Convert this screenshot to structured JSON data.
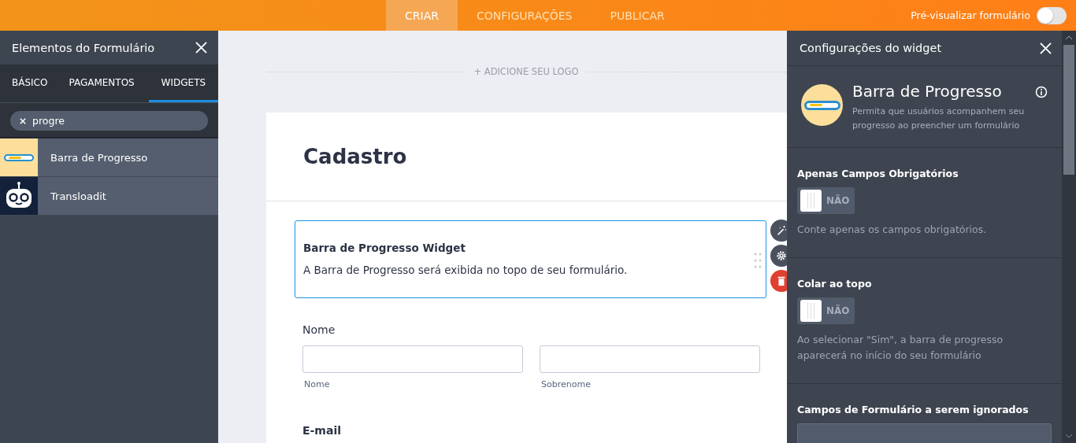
{
  "top_tabs": [
    {
      "label": "CRIAR",
      "selected": true
    },
    {
      "label": "CONFIGURAÇÕES",
      "selected": false
    },
    {
      "label": "PUBLICAR",
      "selected": false
    }
  ],
  "preview": {
    "label": "Pré-visualizar formulário",
    "on": false
  },
  "left_panel": {
    "title": "Elementos do Formulário",
    "tabs": [
      {
        "label": "BÁSICO",
        "selected": false
      },
      {
        "label": "PAGAMENTOS",
        "selected": false
      },
      {
        "label": "WIDGETS",
        "selected": true
      }
    ],
    "search": {
      "value": "progre"
    },
    "items": [
      {
        "label": "Barra de Progresso",
        "kind": "progress"
      },
      {
        "label": "Transloadit",
        "kind": "robot"
      }
    ]
  },
  "form": {
    "add_logo": "+ ADICIONE SEU LOGO",
    "title": "Cadastro",
    "widget": {
      "title": "Barra de Progresso Widget",
      "text": "A Barra de Progresso será exibida no topo de seu formulário."
    },
    "name_field": {
      "label": "Nome",
      "sublabels": [
        "Nome",
        "Sobrenome"
      ]
    },
    "email_label": "E-mail"
  },
  "right_panel": {
    "title": "Configurações do widget",
    "widget_name": "Barra de Progresso",
    "widget_desc": "Permita que usuários acompanhem seu progresso ao preencher um formulário",
    "settings": [
      {
        "kind": "toggle",
        "label": "Apenas Campos Obrigatórios",
        "on": false,
        "toggle_text": "NÃO",
        "hint": "Conte apenas os campos obrigatórios."
      },
      {
        "kind": "toggle",
        "label": "Colar ao topo",
        "on": false,
        "toggle_text": "NÃO",
        "hint": "Ao selecionar \"Sim\", a barra de progresso aparecerá no início do seu formulário"
      },
      {
        "kind": "field",
        "label": "Campos de Formulário a serem ignorados"
      }
    ]
  }
}
